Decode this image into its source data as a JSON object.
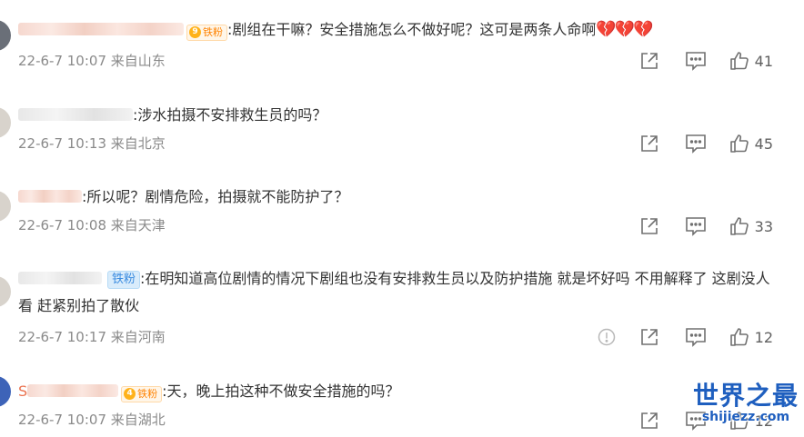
{
  "comments": [
    {
      "name_visible": "",
      "badge_text": "铁粉",
      "badge_level": "9",
      "content": ":剧组在干嘛？安全措施怎么不做好呢？这可是两条人命啊",
      "emoji": "💔💔💔",
      "date": "22-6-7 10:07",
      "location": "来自山东",
      "likes": "41"
    },
    {
      "name_visible": "",
      "content": ":涉水拍摄不安排救生员的吗？",
      "date": "22-6-7 10:13",
      "location": "来自北京",
      "likes": "45"
    },
    {
      "name_visible": "",
      "content": ":所以呢？剧情危险，拍摄就不能防护了？",
      "date": "22-6-7 10:08",
      "location": "来自天津",
      "likes": "33"
    },
    {
      "name_visible": "",
      "badge_text": "铁粉",
      "content": ":在明知道高位剧情的情况下剧组也没有安排救生员以及防护措施 就是坏好吗 不用解释了 这剧没人看 赶紧别拍了散伙",
      "date": "22-6-7 10:17",
      "location": "来自河南",
      "likes": "12"
    },
    {
      "name_visible": "S",
      "badge_text": "铁粉",
      "badge_level": "4",
      "content": ":天，晚上拍这种不做安全措施的吗？",
      "date": "22-6-7 10:07",
      "location": "来自湖北",
      "likes": "12"
    }
  ],
  "watermark": {
    "title": "世界之最",
    "url": "shijiezz.com"
  },
  "icons": {
    "share": "share-icon",
    "reply": "comment-icon",
    "like": "thumbs-up-icon",
    "report": "report-icon"
  },
  "colors": {
    "username": "#eb7350",
    "meta": "#8a8a8a",
    "watermark": "#1f5fbf"
  }
}
